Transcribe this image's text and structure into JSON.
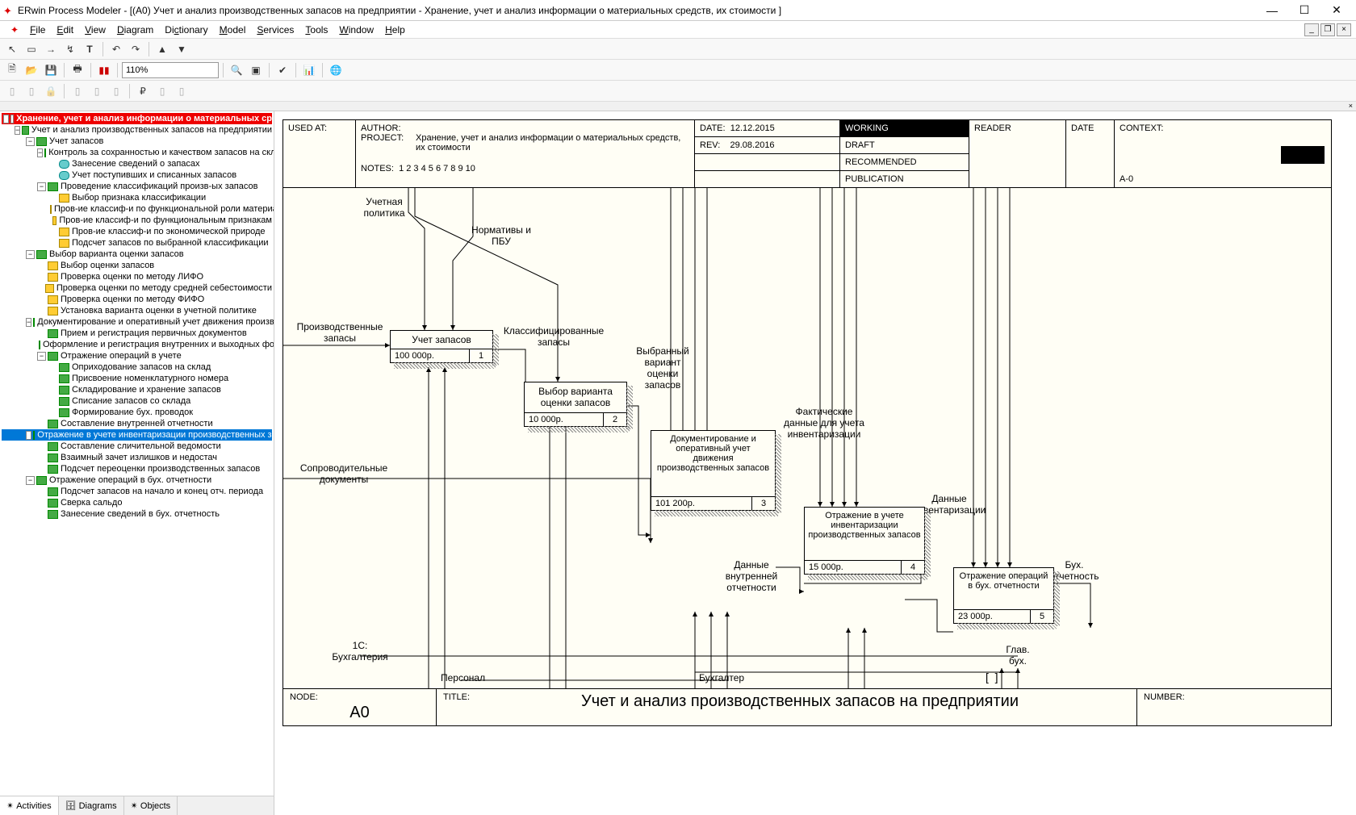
{
  "app": {
    "title": "ERwin Process Modeler - [(A0) Учет и анализ производственных запасов на предприятии - Хранение, учет и анализ информации о материальных средств, их стоимости ]"
  },
  "menu": {
    "file": "File",
    "edit": "Edit",
    "view": "View",
    "diagram": "Diagram",
    "dictionary": "Dictionary",
    "model": "Model",
    "services": "Services",
    "tools": "Tools",
    "window": "Window",
    "help": "Help"
  },
  "toolbar": {
    "zoom": "110%"
  },
  "tree": {
    "root": "Хранение, учет и анализ информации о материальных ср",
    "n1": "Учет и анализ производственных запасов на предприятии",
    "n2": "Учет запасов",
    "n3": "Контроль за  сохранностью и качеством запасов на скла",
    "n4": "Занесение сведений  о запасах",
    "n5": "Учет поступивших и списанных запасов",
    "n6": "Проведение  классификаций произв-ых  запасов",
    "n7": "Выбор признака классификации",
    "n8": "Пров-ие классиф-и по  функциональной роли материал",
    "n9": "Пров-ие классиф-и по функциональным  признакам",
    "n10": "Пров-ие  классиф-и  по  экономической природе",
    "n11": "Подсчет запасов по выбранной классификации",
    "n12": "Выбор варианта  оценки запасов",
    "n13": "Выбор оценки  запасов",
    "n14": "Проверка оценки  по методу ЛИФО",
    "n15": "Проверка оценки по методу средней себестоимости",
    "n16": "Проверка оценки  по методу ФИФО",
    "n17": "Установка варианта оценки в учетной политике",
    "n18": "Документирование  и оперативный учет  движения производ",
    "n19": "Прием и регистрация первичных документов",
    "n20": "Оформление и регистрация  внутренних и выходных форм",
    "n21": "Отражение операций в учете",
    "n22": "Оприходование  запасов на склад",
    "n23": "Присвоение номенклатурного номера",
    "n24": "Складирование  и хранение запасов",
    "n25": "Списание запасов  со склада",
    "n26": "Формирование бух. проводок",
    "n27": "Составление  внутренней  отчетности",
    "n28": "Отражение в учете  инвентаризации  производственных  зап",
    "n29": "Составление  сличительной  ведомости",
    "n30": "Взаимный зачет  излишков и  недостач",
    "n31": "Подсчет  переоценки  производственных  запасов",
    "n32": "Отражение  операций в  бух.  отчетности",
    "n33": "Подсчет запасов  на начало и конец  отч. периода",
    "n34": "Сверка сальдо",
    "n35": "Занесение сведений  в бух. отчетность"
  },
  "tabs": {
    "activities": "Activities",
    "diagrams": "Diagrams",
    "objects": "Objects"
  },
  "idef": {
    "used_at": "USED AT:",
    "author_lbl": "AUTHOR:",
    "project_lbl": "PROJECT:",
    "project": "Хранение, учет и анализ информации о материальных средств, их стоимости",
    "date_lbl": "DATE:",
    "date": "12.12.2015",
    "rev_lbl": "REV:",
    "rev": "29.08.2016",
    "notes_lbl": "NOTES:",
    "notes": "1  2  3  4  5  6  7  8  9  10",
    "working": "WORKING",
    "draft": "DRAFT",
    "recommended": "RECOMMENDED",
    "publication": "PUBLICATION",
    "reader": "READER",
    "date2": "DATE",
    "context": "CONTEXT:",
    "context_val": "A-0",
    "node_lbl": "NODE:",
    "node_val": "A0",
    "title_lbl": "TITLE:",
    "title_val": "Учет и анализ производственных запасов на предприятии",
    "number_lbl": "NUMBER:"
  },
  "boxes": {
    "b1": {
      "title": "Учет запасов",
      "cost": "100 000р.",
      "num": "1"
    },
    "b2": {
      "title": "Выбор варианта оценки запасов",
      "cost": "10 000р.",
      "num": "2"
    },
    "b3": {
      "title": "Документирование и оперативный учет движения производственных запасов",
      "cost": "101 200р.",
      "num": "3"
    },
    "b4": {
      "title": "Отражение в учете инвентаризации производственных запасов",
      "cost": "15 000р.",
      "num": "4"
    },
    "b5": {
      "title": "Отражение операций в бух. отчетности",
      "cost": "23 000р.",
      "num": "5"
    }
  },
  "labels": {
    "l1": "Учетная политика",
    "l2": "Нормативы и ПБУ",
    "l3": "Производственные запасы",
    "l4": "Классифицированные запасы",
    "l5": "Выбранный вариант оценки запасов",
    "l6": "Фактические данные для учета инвентаризации",
    "l7": "Данные инвентаризации",
    "l8": "Сопроводительные документы",
    "l9": "Данные внутренней отчетности",
    "l10": "Бух. отчетность",
    "l11": "1С: Бухгалтерия",
    "l12": "Персонал",
    "l13": "Бухгалтер",
    "l14": "Глав. бух."
  }
}
